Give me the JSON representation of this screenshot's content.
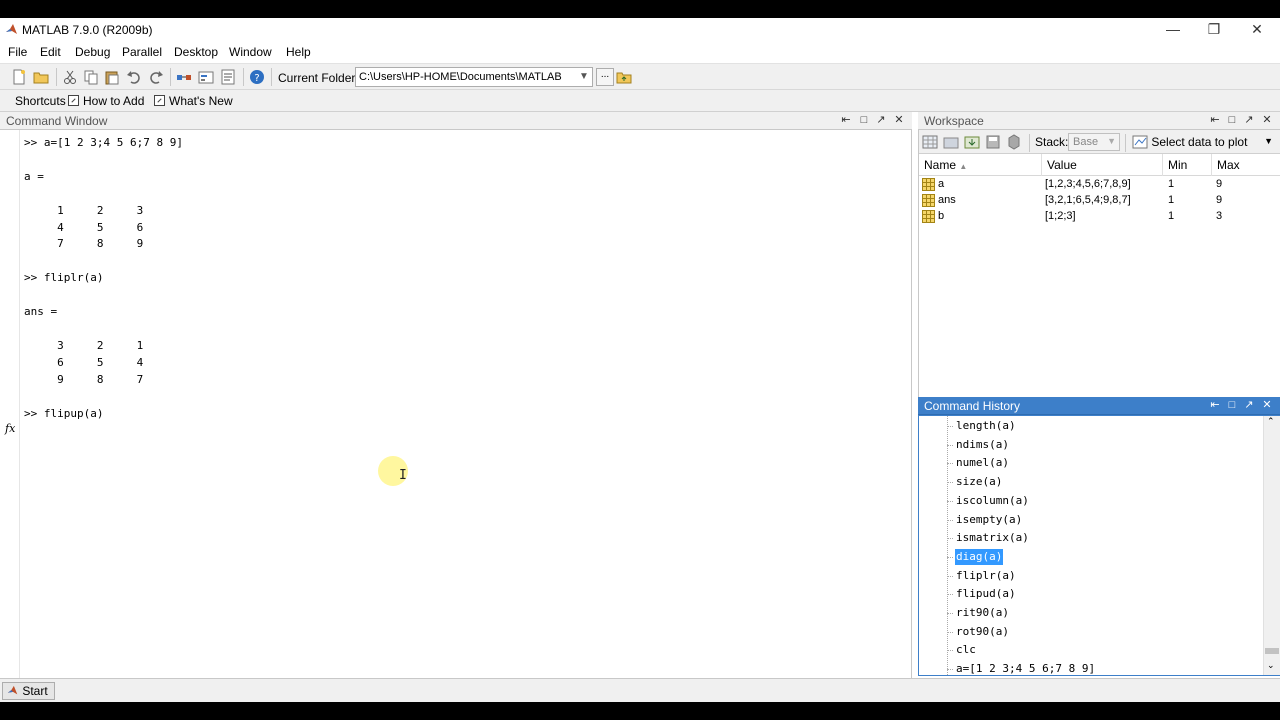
{
  "window": {
    "title": "MATLAB  7.9.0 (R2009b)"
  },
  "menu": [
    "File",
    "Edit",
    "Debug",
    "Parallel",
    "Desktop",
    "Window",
    "Help"
  ],
  "toolbar": {
    "folder_label": "Current Folder:",
    "folder_path": "C:\\Users\\HP-HOME\\Documents\\MATLAB",
    "browse_label": "..."
  },
  "shortcuts": {
    "label": "Shortcuts",
    "items": [
      "How to Add",
      "What's New"
    ]
  },
  "command_window": {
    "title": "Command Window",
    "lines": [
      ">> a=[1 2 3;4 5 6;7 8 9]",
      "",
      "a =",
      "",
      "     1     2     3",
      "     4     5     6",
      "     7     8     9",
      "",
      ">> fliplr(a)",
      "",
      "ans =",
      "",
      "     3     2     1",
      "     6     5     4",
      "     9     8     7",
      "",
      ">> flipup(a)"
    ],
    "fx_label": "fx"
  },
  "workspace": {
    "title": "Workspace",
    "stack_label": "Stack:",
    "stack_value": "Base",
    "plot_label": "Select data to plot",
    "columns": [
      "Name",
      "Value",
      "Min",
      "Max"
    ],
    "rows": [
      {
        "name": "a",
        "value": "[1,2,3;4,5,6;7,8,9]",
        "min": "1",
        "max": "9"
      },
      {
        "name": "ans",
        "value": "[3,2,1;6,5,4;9,8,7]",
        "min": "1",
        "max": "9"
      },
      {
        "name": "b",
        "value": "[1;2;3]",
        "min": "1",
        "max": "3"
      }
    ]
  },
  "history": {
    "title": "Command History",
    "items": [
      "length(a)",
      "ndims(a)",
      "numel(a)",
      "size(a)",
      "iscolumn(a)",
      "isempty(a)",
      "ismatrix(a)",
      "diag(a)",
      "fliplr(a)",
      "flipud(a)",
      "rit90(a)",
      "rot90(a)",
      "clc",
      "a=[1 2 3;4 5 6;7 8 9]"
    ],
    "selected": "diag(a)"
  },
  "statusbar": {
    "start": "Start"
  },
  "colors": {
    "accent": "#3d7fc9",
    "selection": "#3399ff"
  }
}
